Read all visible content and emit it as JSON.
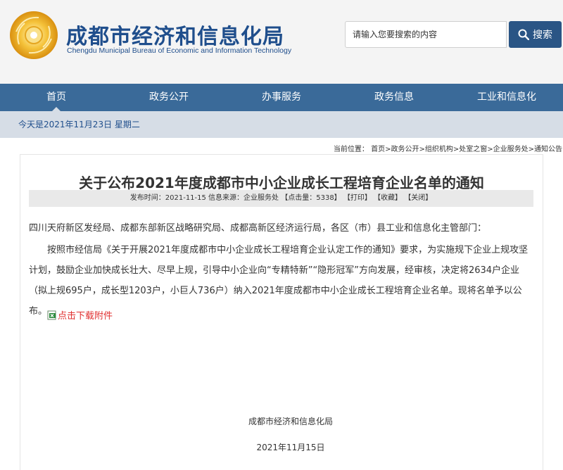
{
  "header": {
    "title": "成都市经济和信息化局",
    "subtitle": "Chengdu Municipal Bureau of Economic and Information Technology",
    "search_placeholder": "请输入您要搜索的内容",
    "search_label": "搜索"
  },
  "nav": {
    "items": [
      "首页",
      "政务公开",
      "办事服务",
      "政务信息",
      "工业和信息化"
    ]
  },
  "date_bar": "今天是2021年11月23日 星期二",
  "breadcrumb": "当前位置：  首页>政务公开>组织机构>处室之窗>企业服务处>通知公告",
  "article": {
    "title": "关于公布2021年度成都市中小企业成长工程培育企业名单的通知",
    "meta": "发布时间：2021-11-15 信息来源：企业服务处 【点击量：5338】 【打印】 【收藏】 【关闭】",
    "recipients": "四川天府新区发经局、成都东部新区战略研究局、成都高新区经济运行局，各区（市）县工业和信息化主管部门：",
    "body": "按照市经信局《关于开展2021年度成都市中小企业成长工程培育企业认定工作的通知》要求，为实施规下企业上规攻坚计划，鼓励企业加快成长壮大、尽早上规，引导中小企业向“专精特新”“隐形冠军”方向发展，经审核，决定将2634户企业（拟上规695户，成长型1203户，小巨人736户）纳入2021年度成都市中小企业成长工程培育企业名单。现将名单予以公布。",
    "download_label": "点击下载附件",
    "signature_org": "成都市经济和信息化局",
    "signature_date": "2021年11月15日"
  },
  "colors": {
    "brand": "#1f4e8c",
    "nav_bg": "#3a6a99",
    "link_red": "#e03030"
  }
}
